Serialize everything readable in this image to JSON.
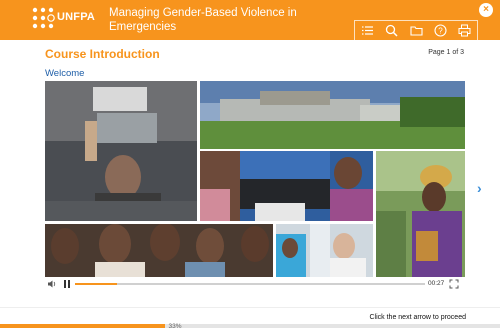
{
  "header": {
    "logo_text": "UNFPA",
    "title": "Managing Gender-Based Violence in Emergencies"
  },
  "toolbar": {
    "items": [
      {
        "icon": "menu-icon"
      },
      {
        "icon": "search-icon"
      },
      {
        "icon": "folder-icon"
      },
      {
        "icon": "help-icon"
      },
      {
        "icon": "print-icon"
      }
    ]
  },
  "close_icon": "close-icon",
  "content": {
    "course_title": "Course Introduction",
    "page_indicator": "Page 1 of 3",
    "section_title": "Welcome"
  },
  "video": {
    "time": "00:27",
    "progress": 0.12
  },
  "footer": {
    "instruction": "Click the next arrow to proceed",
    "progress_label": "33%",
    "progress": 0.33
  },
  "colors": {
    "accent": "#f7941d",
    "section_blue": "#1f5fa8",
    "arrow_blue": "#3b8fd8"
  }
}
